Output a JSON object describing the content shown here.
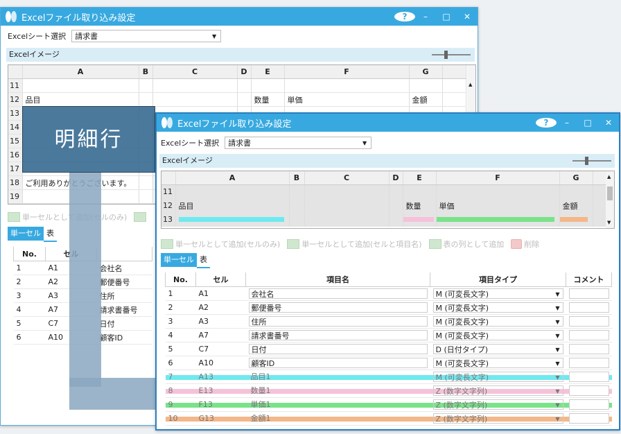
{
  "back": {
    "title": "Excelファイル取り込み設定",
    "sheet_label": "Excelシート選択",
    "sheet_value": "請求書",
    "image_label": "Excelイメージ",
    "columns": [
      "A",
      "B",
      "C",
      "D",
      "E",
      "F",
      "G"
    ],
    "rows": [
      {
        "n": "11",
        "cells": [
          "",
          "",
          "",
          "",
          "",
          "",
          ""
        ]
      },
      {
        "n": "12",
        "cells": [
          "品目",
          "",
          "",
          "",
          "数量",
          "単価",
          "金額"
        ]
      },
      {
        "n": "13",
        "cells": [
          "",
          "",
          "",
          "",
          "",
          "",
          ""
        ]
      },
      {
        "n": "14",
        "cells": [
          "",
          "",
          "",
          "",
          "",
          "",
          ""
        ]
      },
      {
        "n": "15",
        "cells": [
          "",
          "",
          "",
          "",
          "",
          "",
          ""
        ]
      },
      {
        "n": "16",
        "cells": [
          "",
          "",
          "",
          "",
          "",
          "",
          ""
        ]
      },
      {
        "n": "17",
        "cells": [
          "",
          "",
          "",
          "",
          "",
          "",
          ""
        ]
      },
      {
        "n": "18",
        "cells": [
          "ご利用ありがとうございます。",
          "",
          "",
          "",
          "",
          "",
          ""
        ]
      },
      {
        "n": "19",
        "cells": [
          "",
          "",
          "",
          "",
          "",
          "",
          ""
        ]
      }
    ],
    "toolbar_add_single": "単一セルとして追加(セルのみ)",
    "tab_single": "単一セル",
    "tab_table": "表",
    "col_no": "No.",
    "col_cell": "セル",
    "items": [
      {
        "no": "1",
        "cell": "A1",
        "name": "会社名"
      },
      {
        "no": "2",
        "cell": "A2",
        "name": "郵便番号"
      },
      {
        "no": "3",
        "cell": "A3",
        "name": "住所"
      },
      {
        "no": "4",
        "cell": "A7",
        "name": "請求書番号"
      },
      {
        "no": "5",
        "cell": "C7",
        "name": "日付"
      },
      {
        "no": "6",
        "cell": "A10",
        "name": "顧客ID"
      }
    ]
  },
  "callout": "明細行",
  "front": {
    "title": "Excelファイル取り込み設定",
    "sheet_label": "Excelシート選択",
    "sheet_value": "請求書",
    "image_label": "Excelイメージ",
    "columns": [
      "A",
      "B",
      "C",
      "D",
      "E",
      "F",
      "G"
    ],
    "rows": [
      {
        "n": "11",
        "cells": [
          "",
          "",
          "",
          "",
          "",
          "",
          ""
        ]
      },
      {
        "n": "12",
        "cells": [
          "品目",
          "",
          "",
          "",
          "数量",
          "単価",
          "金額"
        ]
      },
      {
        "n": "13",
        "cells": [
          "",
          "",
          "",
          "",
          "",
          "",
          "-"
        ]
      }
    ],
    "toolbar": {
      "add_single_cell_only": "単一セルとして追加(セルのみ)",
      "add_single_with_name": "単一セルとして追加(セルと項目名)",
      "add_table_column": "表の列として追加",
      "delete": "削除"
    },
    "tab_single": "単一セル",
    "tab_table": "表",
    "headers": [
      "No.",
      "セル",
      "項目名",
      "項目タイプ",
      "コメント"
    ],
    "items": [
      {
        "no": "1",
        "cell": "A1",
        "name": "会社名",
        "type": "M (可変長文字)"
      },
      {
        "no": "2",
        "cell": "A2",
        "name": "郵便番号",
        "type": "M (可変長文字)"
      },
      {
        "no": "3",
        "cell": "A3",
        "name": "住所",
        "type": "M (可変長文字)"
      },
      {
        "no": "4",
        "cell": "A7",
        "name": "請求書番号",
        "type": "M (可変長文字)"
      },
      {
        "no": "5",
        "cell": "C7",
        "name": "日付",
        "type": "D (日付タイプ)"
      },
      {
        "no": "6",
        "cell": "A10",
        "name": "顧客ID",
        "type": "M (可変長文字)"
      },
      {
        "no": "7",
        "cell": "A13",
        "name": "品目1",
        "type": "M (可変長文字)"
      },
      {
        "no": "8",
        "cell": "E13",
        "name": "数量1",
        "type": "Z (数字文字列)"
      },
      {
        "no": "9",
        "cell": "F13",
        "name": "単価1",
        "type": "Z (数字文字列)"
      },
      {
        "no": "10",
        "cell": "G13",
        "name": "金額1",
        "type": "Z (数字文字列)"
      }
    ]
  },
  "colors": {
    "accent": "#38a9e0",
    "item_colors": [
      "#6fe9ef",
      "#f6c2d9",
      "#79e38a",
      "#f4b789"
    ]
  }
}
